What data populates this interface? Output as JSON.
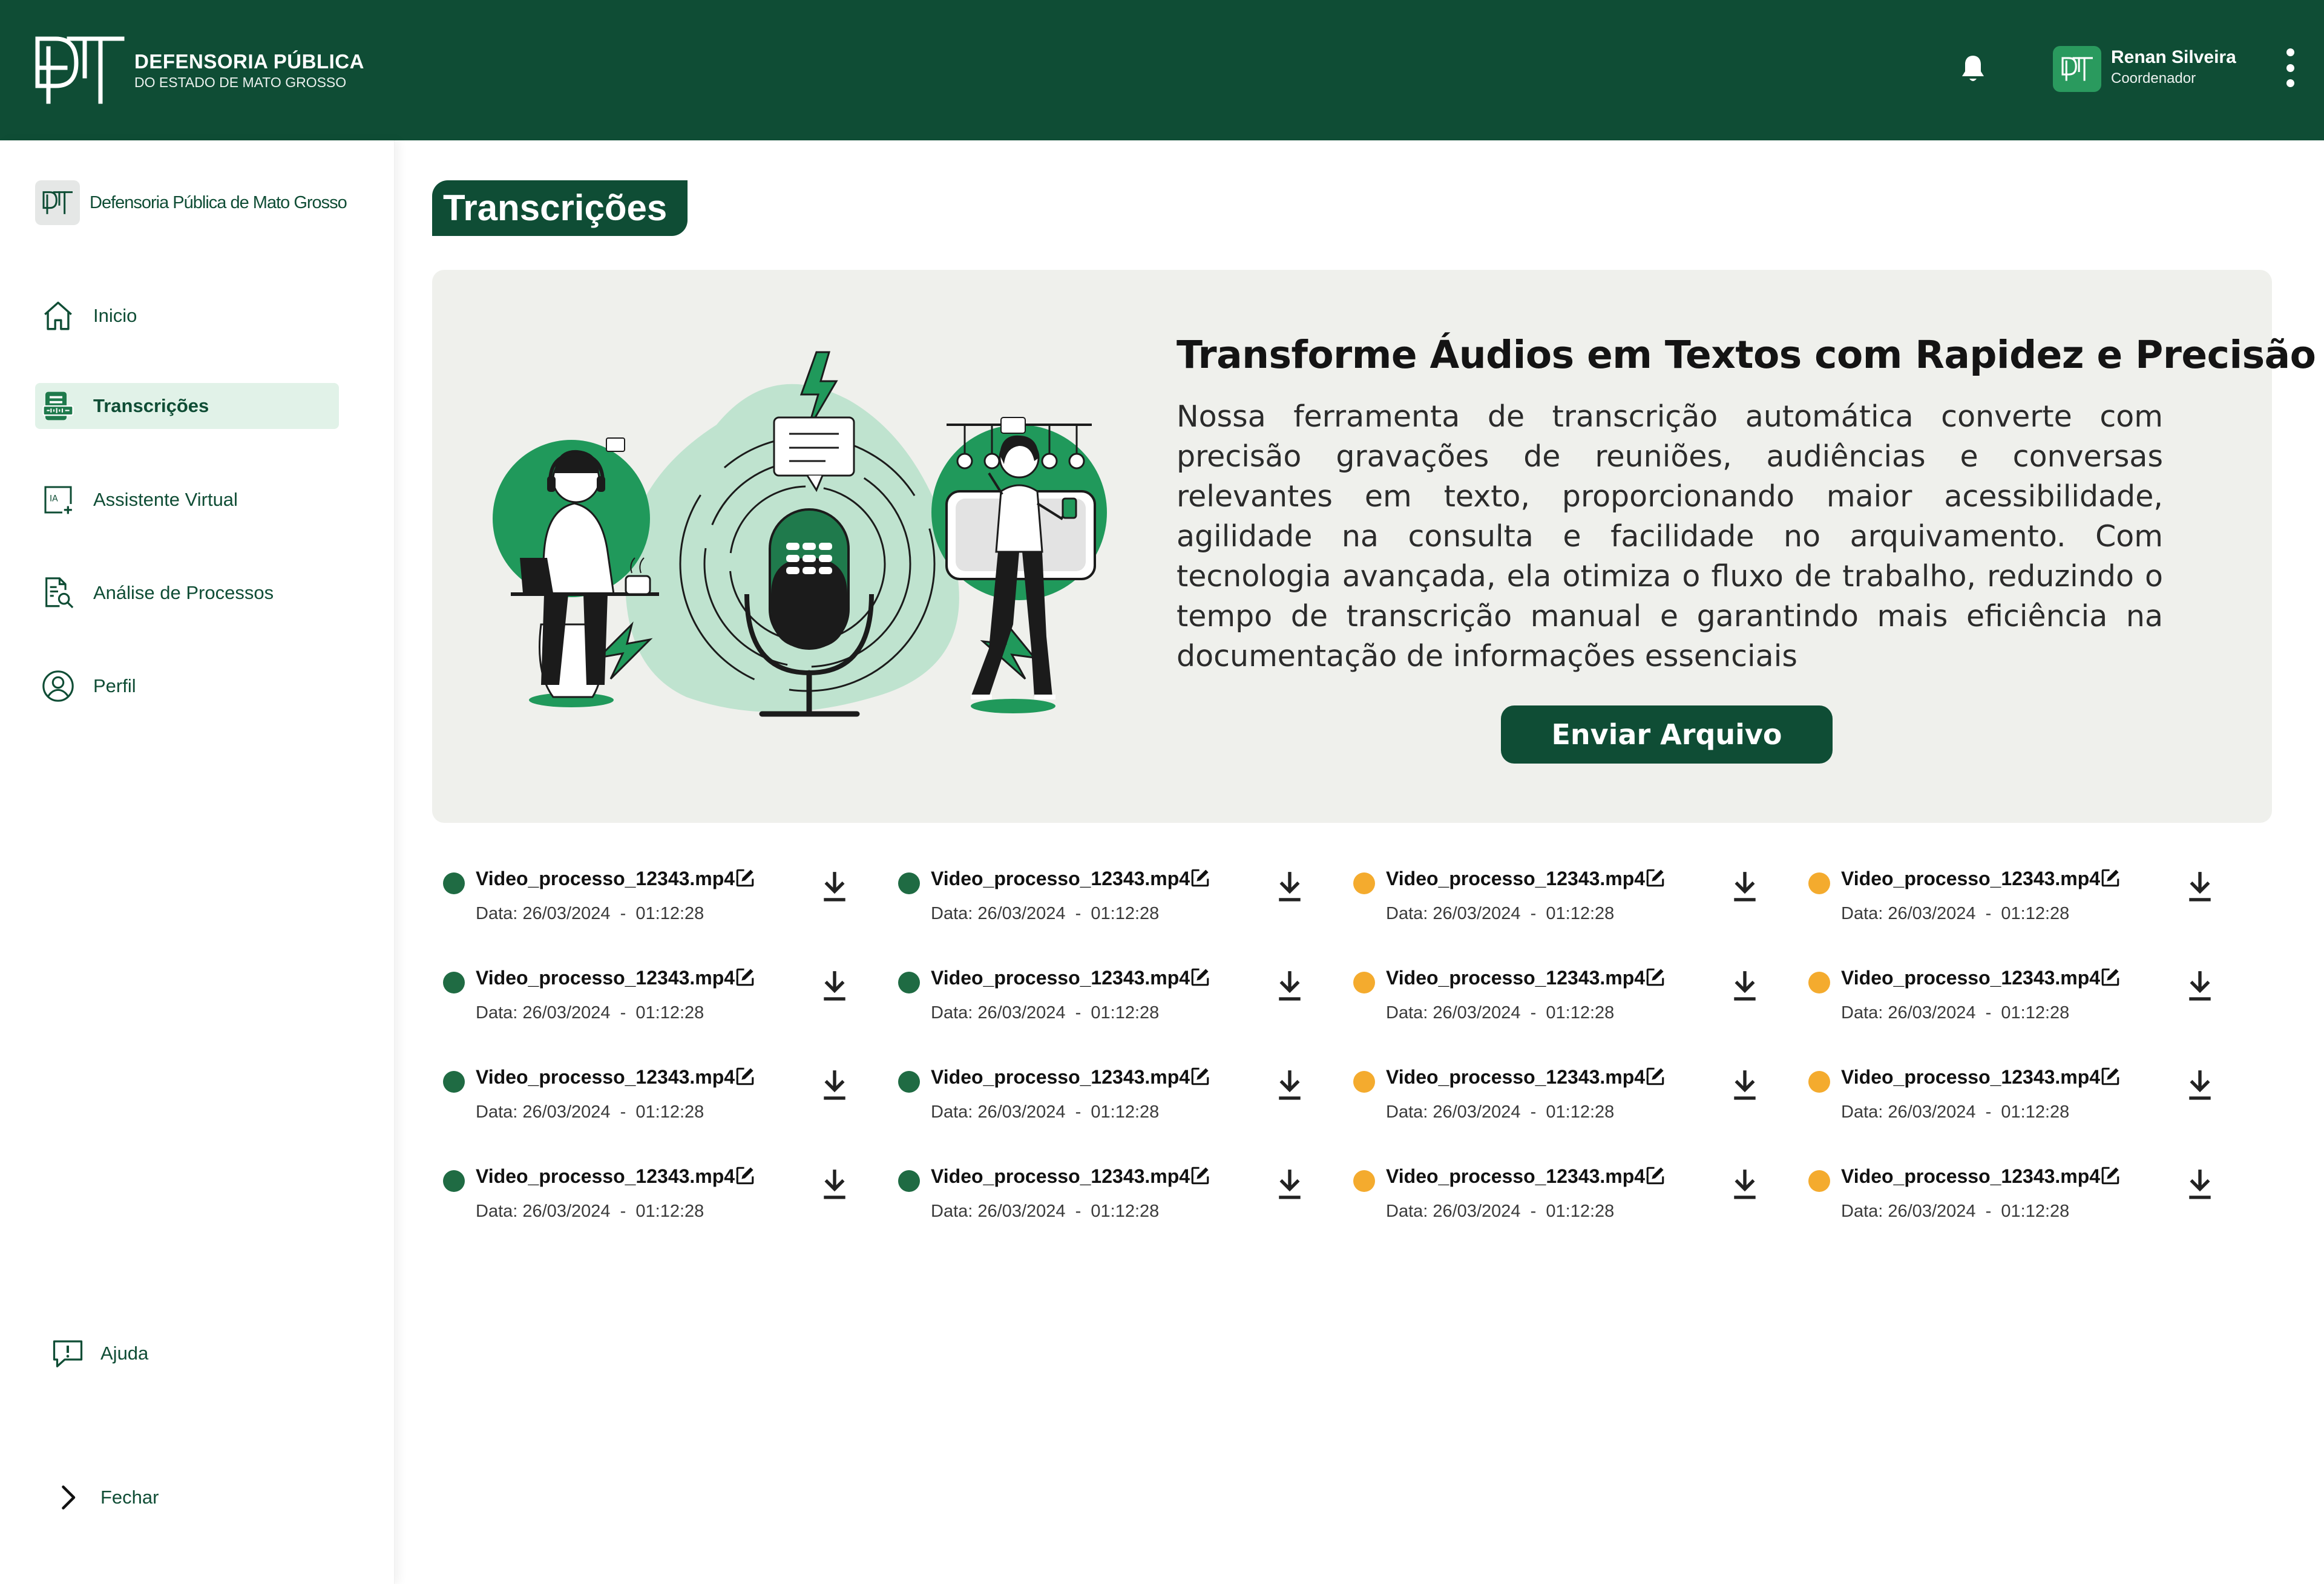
{
  "header": {
    "brand_title": "DEFENSORIA PÚBLICA",
    "brand_subtitle": "DO ESTADO DE MATO GROSSO",
    "user": {
      "name": "Renan Silveira",
      "role": "Coordenador"
    },
    "icons": [
      "bell-icon",
      "user-avatar",
      "more-vertical-icon"
    ]
  },
  "sidebar": {
    "org_name": "Defensoria Pública de Mato Grosso",
    "items": [
      {
        "label": "Inicio",
        "icon": "home-icon",
        "active": false
      },
      {
        "label": "Transcrições",
        "icon": "transcription-icon",
        "active": true
      },
      {
        "label": "Assistente Virtual",
        "icon": "ai-assistant-icon",
        "active": false
      },
      {
        "label": "Análise de Processos",
        "icon": "document-search-icon",
        "active": false
      },
      {
        "label": "Perfil",
        "icon": "user-icon",
        "active": false
      }
    ],
    "help_label": "Ajuda",
    "close_label": "Fechar"
  },
  "main": {
    "title": "Transcrições",
    "hero": {
      "heading": "Transforme Áudios em Textos com Rapidez e Precisão",
      "body": "Nossa ferramenta de transcrição automática converte com precisão gravações de reuniões, audiências e conversas relevantes em texto, proporcionando maior acessibilidade, agilidade na consulta e facilidade no arquivamento. Com tecnologia avançada, ela otimiza o fluxo de trabalho, reduzindo o tempo de transcrição manual e garantindo mais eficiência na documentação de informações essenciais",
      "button_label": "Enviar Arquivo"
    },
    "colors": {
      "done": "#1f6b43",
      "pending": "#f4ab2e",
      "brand": "#0f4d35"
    },
    "files": [
      {
        "name": "Video_processo_12343.mp4",
        "date": "Data: 26/03/2024  -  01:12:28",
        "status": "done"
      },
      {
        "name": "Video_processo_12343.mp4",
        "date": "Data: 26/03/2024  -  01:12:28",
        "status": "done"
      },
      {
        "name": "Video_processo_12343.mp4",
        "date": "Data: 26/03/2024  -  01:12:28",
        "status": "pending"
      },
      {
        "name": "Video_processo_12343.mp4",
        "date": "Data: 26/03/2024  -  01:12:28",
        "status": "pending"
      },
      {
        "name": "Video_processo_12343.mp4",
        "date": "Data: 26/03/2024  -  01:12:28",
        "status": "done"
      },
      {
        "name": "Video_processo_12343.mp4",
        "date": "Data: 26/03/2024  -  01:12:28",
        "status": "done"
      },
      {
        "name": "Video_processo_12343.mp4",
        "date": "Data: 26/03/2024  -  01:12:28",
        "status": "pending"
      },
      {
        "name": "Video_processo_12343.mp4",
        "date": "Data: 26/03/2024  -  01:12:28",
        "status": "pending"
      },
      {
        "name": "Video_processo_12343.mp4",
        "date": "Data: 26/03/2024  -  01:12:28",
        "status": "done"
      },
      {
        "name": "Video_processo_12343.mp4",
        "date": "Data: 26/03/2024  -  01:12:28",
        "status": "done"
      },
      {
        "name": "Video_processo_12343.mp4",
        "date": "Data: 26/03/2024  -  01:12:28",
        "status": "pending"
      },
      {
        "name": "Video_processo_12343.mp4",
        "date": "Data: 26/03/2024  -  01:12:28",
        "status": "pending"
      },
      {
        "name": "Video_processo_12343.mp4",
        "date": "Data: 26/03/2024  -  01:12:28",
        "status": "done"
      },
      {
        "name": "Video_processo_12343.mp4",
        "date": "Data: 26/03/2024  -  01:12:28",
        "status": "done"
      },
      {
        "name": "Video_processo_12343.mp4",
        "date": "Data: 26/03/2024  -  01:12:28",
        "status": "pending"
      },
      {
        "name": "Video_processo_12343.mp4",
        "date": "Data: 26/03/2024  -  01:12:28",
        "status": "pending"
      }
    ]
  }
}
